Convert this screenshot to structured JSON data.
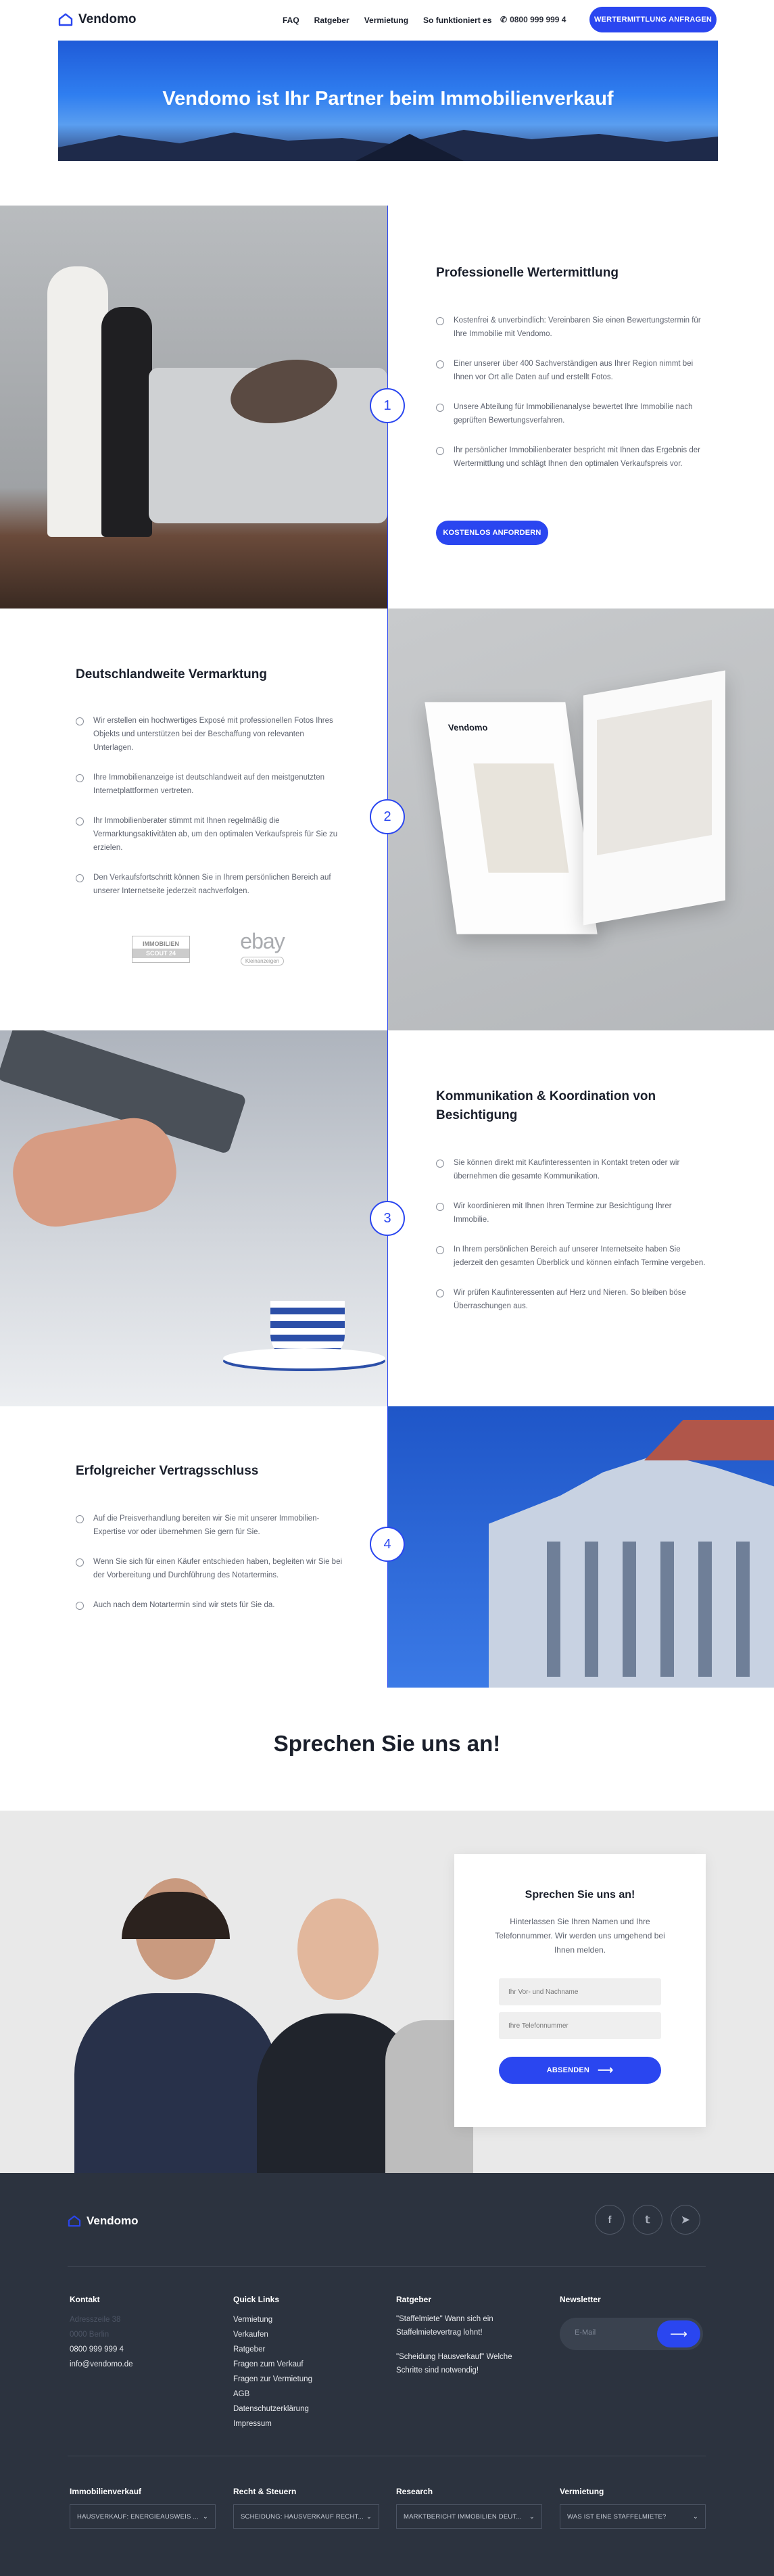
{
  "header": {
    "brand": "Vendomo",
    "nav": [
      "FAQ",
      "Ratgeber",
      "Vermietung",
      "So funktioniert es"
    ],
    "phone": "0800 999 999 4",
    "cta": "WERTERMITTLUNG ANFRAGEN"
  },
  "hero": {
    "title": "Vendomo ist Ihr Partner beim Immobilienverkauf"
  },
  "steps": [
    {
      "number": "1",
      "title": "Professionelle Wertermittlung",
      "bullets": [
        "Kostenfrei & unverbindlich: Vereinbaren Sie einen Bewertungstermin für Ihre Immobilie mit Vendomo.",
        "Einer unserer über 400 Sachverständigen aus Ihrer Region nimmt bei Ihnen vor Ort alle Daten auf und erstellt Fotos.",
        "Unsere Abteilung für Immobilienanalyse bewertet Ihre Immobilie nach geprüften Bewertungsverfahren.",
        "Ihr persönlicher Immobilienberater bespricht mit Ihnen das Ergebnis der Wertermittlung und schlägt Ihnen den optimalen Verkaufspreis vor."
      ],
      "button": "KOSTENLOS ANFORDERN"
    },
    {
      "number": "2",
      "title": "Deutschlandweite Vermarktung",
      "bullets": [
        "Wir erstellen ein hochwertiges Exposé mit professionellen Fotos Ihres Objekts und unterstützen bei der Beschaffung von relevanten Unterlagen.",
        "Ihre Immobilienanzeige ist deutschlandweit auf den meistgenutzten Internetplattformen vertreten.",
        "Ihr Immobilienberater stimmt mit Ihnen regelmäßig die Vermarktungsaktivitäten ab, um den optimalen Verkaufspreis für Sie zu erzielen.",
        "Den Verkaufsfortschritt können Sie in Ihrem persönlichen Bereich auf unserer Internetseite jederzeit nachverfolgen."
      ],
      "logos": {
        "immo_top": "IMMOBILIEN",
        "immo_bottom": "SCOUT 24",
        "ebay": "ebay",
        "ebay_sub": "Kleinanzeigen"
      },
      "brochure_brand": "Vendomo"
    },
    {
      "number": "3",
      "title": "Kommunikation & Koordination von Besichtigung",
      "bullets": [
        "Sie können direkt mit Kaufinteressenten in Kontakt treten oder wir übernehmen die gesamte Kommunikation.",
        "Wir koordinieren mit Ihnen Ihren Termine zur Besichtigung Ihrer Immobilie.",
        "In Ihrem persönlichen Bereich auf unserer Internetseite haben Sie jederzeit den gesamten Überblick und können einfach Termine vergeben.",
        "Wir prüfen Kaufinteressenten auf Herz und Nieren. So bleiben böse Überraschungen aus."
      ]
    },
    {
      "number": "4",
      "title": "Erfolgreicher Vertragsschluss",
      "bullets": [
        "Auf die Preisverhandlung bereiten wir Sie mit unserer Immobilien-Expertise vor oder übernehmen Sie gern für Sie.",
        "Wenn Sie sich für einen Käufer entschieden haben, begleiten wir Sie bei der Vorbereitung und Durchführung des Notartermins.",
        "Auch nach dem Notartermin sind wir stets für Sie da."
      ]
    }
  ],
  "contact": {
    "heading": "Sprechen Sie uns an!",
    "card_title": "Sprechen Sie uns an!",
    "card_text": "Hinterlassen Sie Ihren Namen und Ihre Telefonnummer. Wir werden uns umgehend bei Ihnen melden.",
    "name_placeholder": "Ihr Vor- und Nachname",
    "phone_placeholder": "Ihre Telefonnummer",
    "submit": "ABSENDEN"
  },
  "footer": {
    "brand": "Vendomo",
    "contact": {
      "title": "Kontakt",
      "address1": "Adresszeile 38",
      "address2": "0000 Berlin",
      "phone": "0800 999 999 4",
      "email": "info@vendomo.de"
    },
    "quick": {
      "title": "Quick Links",
      "items": [
        "Vermietung",
        "Verkaufen",
        "Ratgeber",
        "Fragen zum Verkauf",
        "Fragen zur Vermietung",
        "AGB",
        "Datenschutzerklärung",
        "Impressum"
      ]
    },
    "guide": {
      "title": "Ratgeber",
      "items": [
        "\"Staffelmiete\" Wann sich ein Staffelmietevertrag lohnt!",
        "\"Scheidung Hausverkauf\" Welche Schritte sind notwendig!"
      ]
    },
    "newsletter": {
      "title": "Newsletter",
      "placeholder": "E-Mail"
    },
    "selects": [
      {
        "title": "Immobilienverkauf",
        "value": "HAUSVERKAUF: ENERGIEAUSWEIS ..."
      },
      {
        "title": "Recht & Steuern",
        "value": "SCHEIDUNG: HAUSVERKAUF RECHT..."
      },
      {
        "title": "Research",
        "value": "MARKTBERICHT IMMOBILIEN DEUT..."
      },
      {
        "title": "Vermietung",
        "value": "WAS IST EINE STAFFELMIETE?"
      }
    ]
  },
  "colors": {
    "accent": "#2a46f0",
    "footer": "#2c333f",
    "text": "#1a1f2b"
  }
}
